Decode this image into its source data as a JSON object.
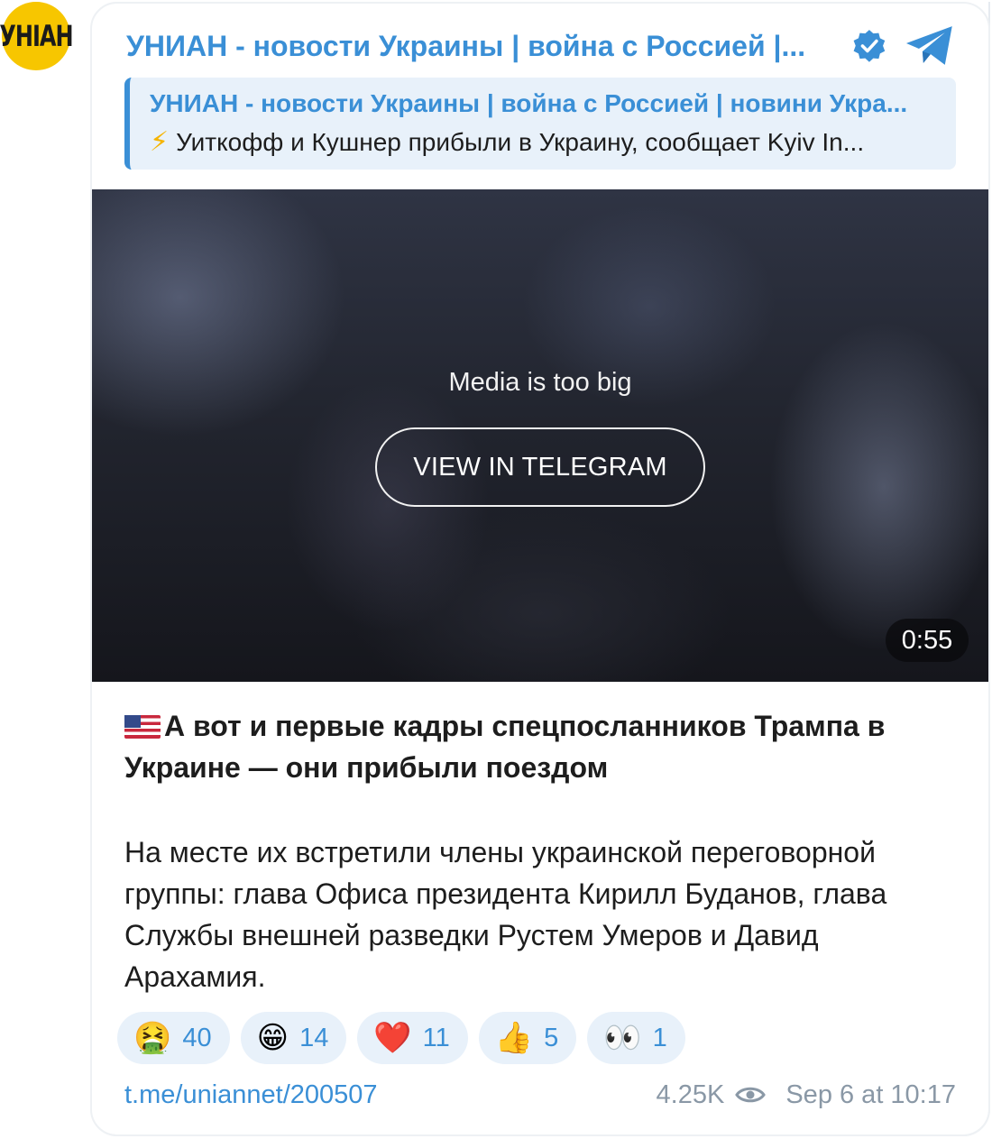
{
  "channel": {
    "avatar_text": "УНIАН",
    "title": "УНИАН - новости Украины | война с Россией |..."
  },
  "reply": {
    "title": "УНИАН - новости Украины | война с Россией | новини Укра...",
    "snippet": "Уиткофф и Кушнер прибыли в Украину, сообщает Kyiv In..."
  },
  "media": {
    "message": "Media is too big",
    "button_label": "VIEW IN TELEGRAM",
    "duration": "0:55"
  },
  "post": {
    "headline": "А вот и первые кадры спецпосланников Трампа в Украине — они прибыли поездом",
    "body": "На месте их встретили члены украинской переговорной группы: глава Офиса президента Кирилл Буданов, глава Службы внешней разведки Рустем Умеров и Давид Арахамия."
  },
  "reactions": [
    {
      "emoji": "🤮",
      "count": "40"
    },
    {
      "emoji": "😁",
      "count": "14"
    },
    {
      "emoji": "❤️",
      "count": "11"
    },
    {
      "emoji": "👍",
      "count": "5"
    },
    {
      "emoji": "👀",
      "count": "1"
    }
  ],
  "footer": {
    "link": "t.me/uniannet/200507",
    "views": "4.25K",
    "date": "Sep 6 at 10:17"
  },
  "colors": {
    "accent": "#3a8fd6",
    "avatar_bg": "#f7c600",
    "reply_bg": "#e8f1fa",
    "muted": "#8a98a6"
  }
}
